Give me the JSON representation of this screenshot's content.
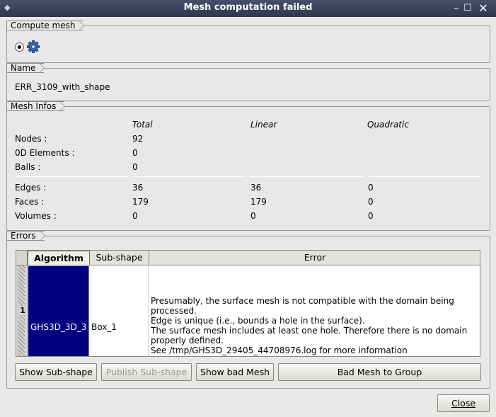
{
  "window": {
    "title": "Mesh computation failed"
  },
  "compute_mesh": {
    "label": "Compute mesh"
  },
  "name_group": {
    "label": "Name",
    "value": "ERR_3109_with_shape"
  },
  "mesh_infos": {
    "label": "Mesh Infos",
    "headers": {
      "total": "Total",
      "linear": "Linear",
      "quadratic": "Quadratic"
    },
    "rows": {
      "nodes": {
        "label": "Nodes :",
        "total": "92",
        "linear": "",
        "quadratic": ""
      },
      "elements0d": {
        "label": "0D Elements :",
        "total": "0",
        "linear": "",
        "quadratic": ""
      },
      "balls": {
        "label": "Balls :",
        "total": "0",
        "linear": "",
        "quadratic": ""
      },
      "edges": {
        "label": "Edges :",
        "total": "36",
        "linear": "36",
        "quadratic": "0"
      },
      "faces": {
        "label": "Faces :",
        "total": "179",
        "linear": "179",
        "quadratic": "0"
      },
      "volumes": {
        "label": "Volumes :",
        "total": "0",
        "linear": "0",
        "quadratic": "0"
      }
    }
  },
  "errors": {
    "label": "Errors",
    "columns": {
      "algorithm": "Algorithm",
      "sub_shape": "Sub-shape",
      "error": "Error"
    },
    "row": {
      "number": "1",
      "algorithm": "GHS3D_3D_3",
      "sub_shape": "Box_1",
      "error": "Presumably, the surface mesh is not compatible with the domain being processed.\nEdge is unique (i.e., bounds a hole in the surface).\nThe surface mesh includes at least one hole. Therefore there is no domain properly defined.\nSee /tmp/GHS3D_29405_44708976.log for more information"
    }
  },
  "buttons": {
    "show_sub_shape": "Show Sub-shape",
    "publish_sub_shape": "Publish Sub-shape",
    "show_bad_mesh": "Show bad Mesh",
    "bad_mesh_to_group": "Bad Mesh to Group",
    "close": "Close"
  },
  "colors": {
    "titlebar": "#3a4258",
    "selection": "#000080",
    "background": "#eae8e6"
  }
}
